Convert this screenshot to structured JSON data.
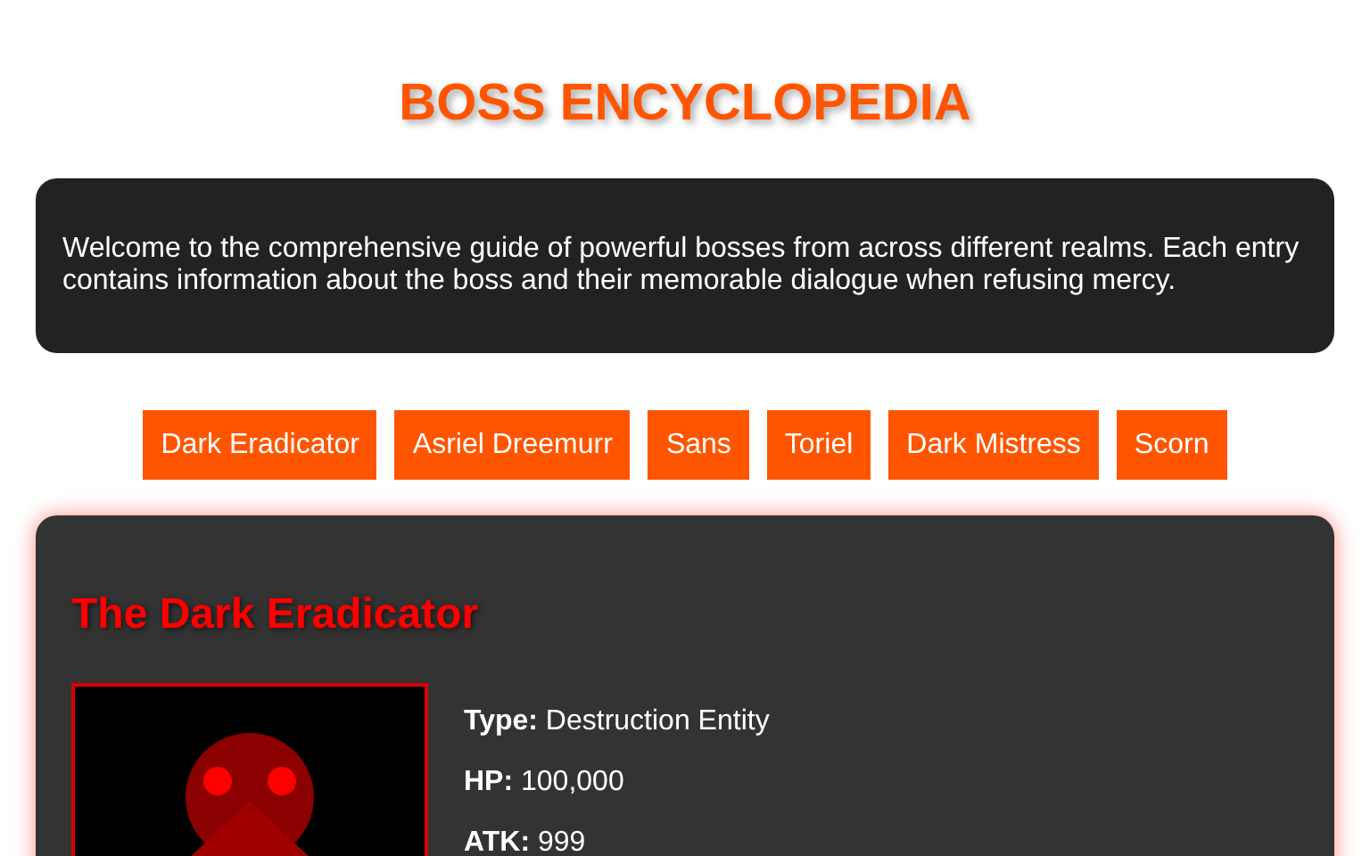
{
  "title": "BOSS ENCYCLOPEDIA",
  "intro": "Welcome to the comprehensive guide of powerful bosses from across different realms. Each entry contains information about the boss and their memorable dialogue when refusing mercy.",
  "boss_buttons": [
    "Dark Eradicator",
    "Asriel Dreemurr",
    "Sans",
    "Toriel",
    "Dark Mistress",
    "Scorn"
  ],
  "boss": {
    "name": "The Dark Eradicator",
    "stats": [
      "**Type:** Destruction Entity",
      "**HP:** 100,000",
      "**ATK:** 999"
    ]
  }
}
